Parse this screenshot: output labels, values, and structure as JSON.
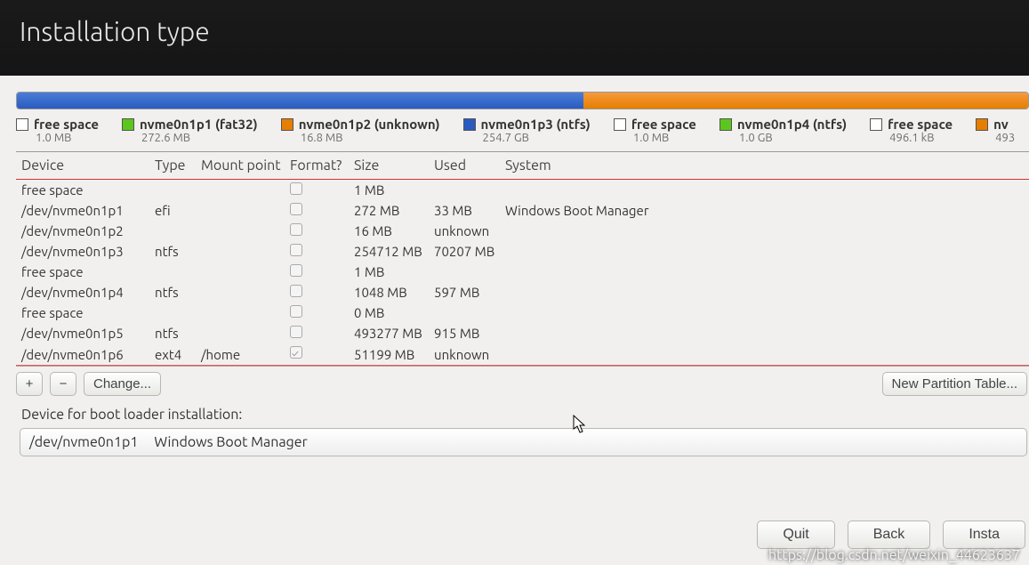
{
  "header": {
    "title": "Installation type"
  },
  "legend": [
    {
      "swatch": "sw-white",
      "label": "free space",
      "sub": "1.0 MB"
    },
    {
      "swatch": "sw-green",
      "label": "nvme0n1p1 (fat32)",
      "sub": "272.6 MB"
    },
    {
      "swatch": "sw-orange",
      "label": "nvme0n1p2 (unknown)",
      "sub": "16.8 MB"
    },
    {
      "swatch": "sw-blue",
      "label": "nvme0n1p3 (ntfs)",
      "sub": "254.7 GB"
    },
    {
      "swatch": "sw-white",
      "label": "free space",
      "sub": "1.0 MB"
    },
    {
      "swatch": "sw-green",
      "label": "nvme0n1p4 (ntfs)",
      "sub": "1.0 GB"
    },
    {
      "swatch": "sw-white",
      "label": "free space",
      "sub": "496.1 kB"
    },
    {
      "swatch": "sw-orange",
      "label": "nv",
      "sub": "493"
    }
  ],
  "columns": {
    "device": "Device",
    "type": "Type",
    "mount": "Mount point",
    "format": "Format?",
    "size": "Size",
    "used": "Used",
    "system": "System"
  },
  "rows": [
    {
      "device": "free space",
      "type": "",
      "mount": "",
      "format": false,
      "size": "1 MB",
      "used": "",
      "system": ""
    },
    {
      "device": "/dev/nvme0n1p1",
      "type": "efi",
      "mount": "",
      "format": false,
      "size": "272 MB",
      "used": "33 MB",
      "system": "Windows Boot Manager"
    },
    {
      "device": "/dev/nvme0n1p2",
      "type": "",
      "mount": "",
      "format": false,
      "size": "16 MB",
      "used": "unknown",
      "system": ""
    },
    {
      "device": "/dev/nvme0n1p3",
      "type": "ntfs",
      "mount": "",
      "format": false,
      "size": "254712 MB",
      "used": "70207 MB",
      "system": ""
    },
    {
      "device": "free space",
      "type": "",
      "mount": "",
      "format": false,
      "size": "1 MB",
      "used": "",
      "system": ""
    },
    {
      "device": "/dev/nvme0n1p4",
      "type": "ntfs",
      "mount": "",
      "format": false,
      "size": "1048 MB",
      "used": "597 MB",
      "system": ""
    },
    {
      "device": "free space",
      "type": "",
      "mount": "",
      "format": false,
      "size": "0 MB",
      "used": "",
      "system": ""
    },
    {
      "device": "/dev/nvme0n1p5",
      "type": "ntfs",
      "mount": "",
      "format": false,
      "size": "493277 MB",
      "used": "915 MB",
      "system": ""
    },
    {
      "device": "/dev/nvme0n1p6",
      "type": "ext4",
      "mount": "/home",
      "format": true,
      "size": "51199 MB",
      "used": "unknown",
      "system": ""
    }
  ],
  "toolbar": {
    "add": "+",
    "remove": "−",
    "change": "Change...",
    "new_table": "New Partition Table..."
  },
  "boot_label": "Device for boot loader installation:",
  "boot_combo": {
    "device": "/dev/nvme0n1p1",
    "desc": "Windows Boot Manager"
  },
  "footer": {
    "quit": "Quit",
    "back": "Back",
    "install": "Insta"
  },
  "watermark": "https://blog.csdn.net/weixin_44623637"
}
